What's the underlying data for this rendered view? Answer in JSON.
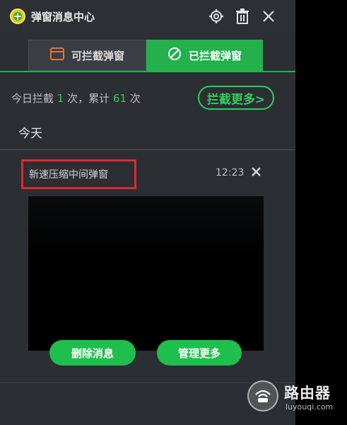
{
  "window": {
    "title": "弹窗消息中心",
    "accent_color": "#22b14c"
  },
  "header": {
    "icons": [
      "settings-gear-icon",
      "trash-icon",
      "close-icon"
    ]
  },
  "tabs": [
    {
      "label": "可拦截弹窗",
      "icon": "window-icon",
      "active": false
    },
    {
      "label": "已拦截弹窗",
      "icon": "blocked-circle-icon",
      "active": true
    }
  ],
  "stats": {
    "prefix": "今日拦截",
    "today_count": "1",
    "mid": "次，累计",
    "total_count": "61",
    "suffix": "次",
    "more_button": "拦截更多>"
  },
  "section": {
    "heading": "今天"
  },
  "message": {
    "title": "新速压缩中间弹窗",
    "time": "12:23"
  },
  "actions": {
    "delete_label": "删除消息",
    "manage_label": "管理更多"
  },
  "watermark": {
    "title": "路由器",
    "subtitle": "luyouqi.com"
  }
}
